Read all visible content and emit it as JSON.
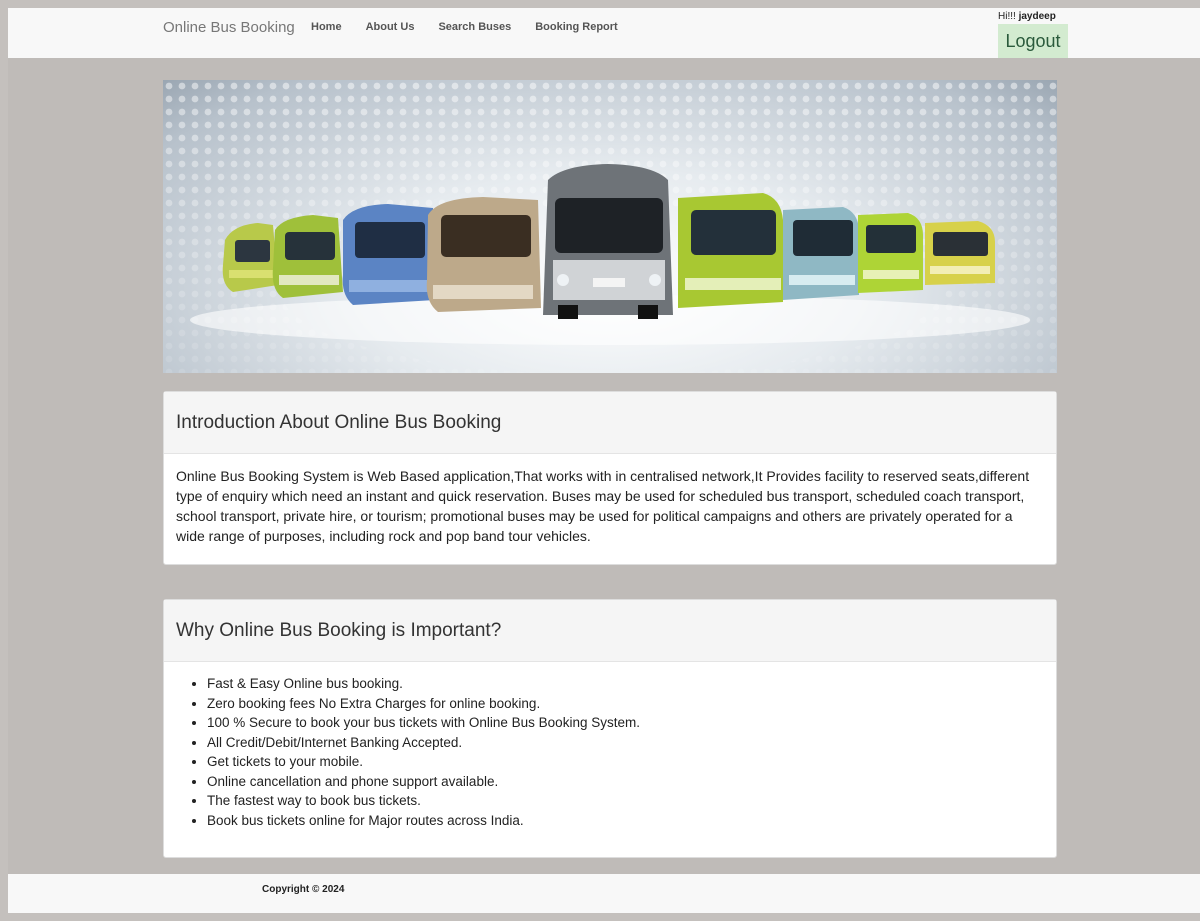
{
  "navbar": {
    "brand": "Online Bus Booking",
    "links": [
      "Home",
      "About Us",
      "Search Buses",
      "Booking Report"
    ],
    "greeting_prefix": "Hi!!!",
    "username": "jaydeep",
    "logout_label": "Logout"
  },
  "intro": {
    "title": "Introduction About Online Bus Booking",
    "body": "Online Bus Booking System is Web Based application,That works with in centralised network,It Provides facility to reserved seats,different type of enquiry which need an instant and quick reservation. Buses may be used for scheduled bus transport, scheduled coach transport, school transport, private hire, or tourism; promotional buses may be used for political campaigns and others are privately operated for a wide range of purposes, including rock and pop band tour vehicles."
  },
  "why": {
    "title": "Why Online Bus Booking is Important?",
    "items": [
      "Fast & Easy Online bus booking.",
      "Zero booking fees No Extra Charges for online booking.",
      "100 % Secure to book your bus tickets with Online Bus Booking System.",
      "All Credit/Debit/Internet Banking Accepted.",
      "Get tickets to your mobile.",
      "Online cancellation and phone support available.",
      "The fastest way to book bus tickets.",
      "Book bus tickets online for Major routes across India."
    ]
  },
  "footer": {
    "copyright": "Copyright © 2024"
  },
  "colors": {
    "page_bg": "#bfbbb8",
    "navbar_bg": "#f8f8f8",
    "logout_bg": "#d3ebd0"
  }
}
